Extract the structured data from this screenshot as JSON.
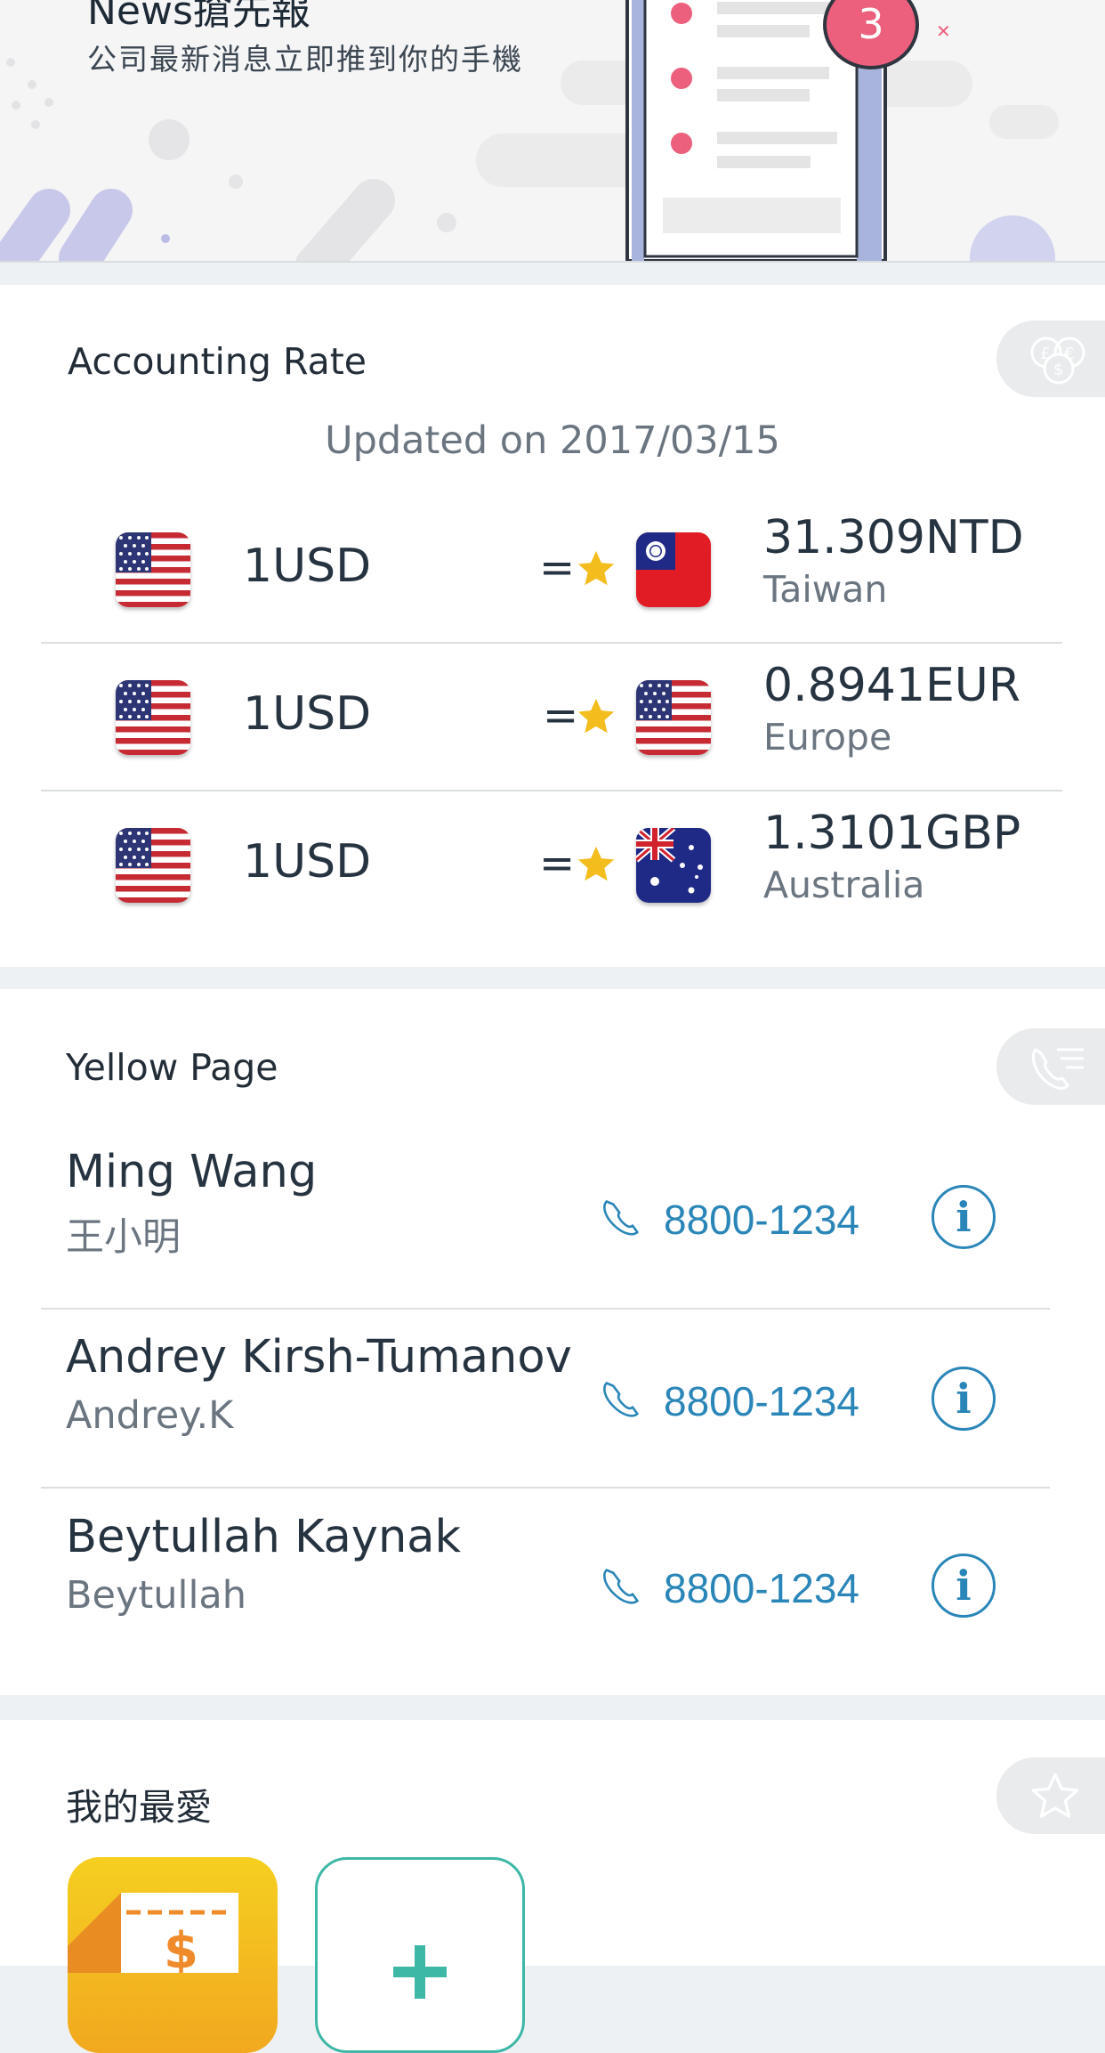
{
  "banner": {
    "title": "News搶先報",
    "subtitle": "公司最新消息立即推到你的手機",
    "badge_count": "3"
  },
  "accounting": {
    "title": "Accounting Rate",
    "pill_icon": "currency-coins-icon",
    "updated": "Updated on 2017/03/15",
    "rows": [
      {
        "amount": "1USD",
        "equals": "=",
        "rate": "31.309NTD",
        "region": "Taiwan",
        "from_flag": "us-flag-icon",
        "to_flag": "taiwan-flag-icon"
      },
      {
        "amount": "1USD",
        "equals": "=",
        "rate": "0.8941EUR",
        "region": "Europe",
        "from_flag": "us-flag-icon",
        "to_flag": "us-flag-icon"
      },
      {
        "amount": "1USD",
        "equals": "=",
        "rate": "1.3101GBP",
        "region": "Australia",
        "from_flag": "us-flag-icon",
        "to_flag": "australia-flag-icon"
      }
    ]
  },
  "yellow_page": {
    "title": "Yellow Page",
    "pill_icon": "phone-list-icon",
    "contacts": [
      {
        "name": "Ming Wang",
        "alias": "王小明",
        "phone": "8800-1234",
        "info": "i"
      },
      {
        "name": "Andrey Kirsh-Tumanov",
        "alias": "Andrey.K",
        "phone": "8800-1234",
        "info": "i"
      },
      {
        "name": "Beytullah Kaynak",
        "alias": "Beytullah",
        "phone": "8800-1234",
        "info": "i"
      }
    ]
  },
  "favorites": {
    "title": "我的最愛",
    "pill_icon": "star-outline-icon",
    "tiles": [
      {
        "icon": "coupon-dollar-icon"
      },
      {
        "icon": "add-plus-icon"
      }
    ]
  },
  "colors": {
    "accent_blue": "#2a86b8",
    "star_yellow": "#f2bd1d",
    "badge_pink": "#ec5f7d",
    "tile_yellow": "#f5c51f",
    "tile_teal": "#3db7a6"
  }
}
